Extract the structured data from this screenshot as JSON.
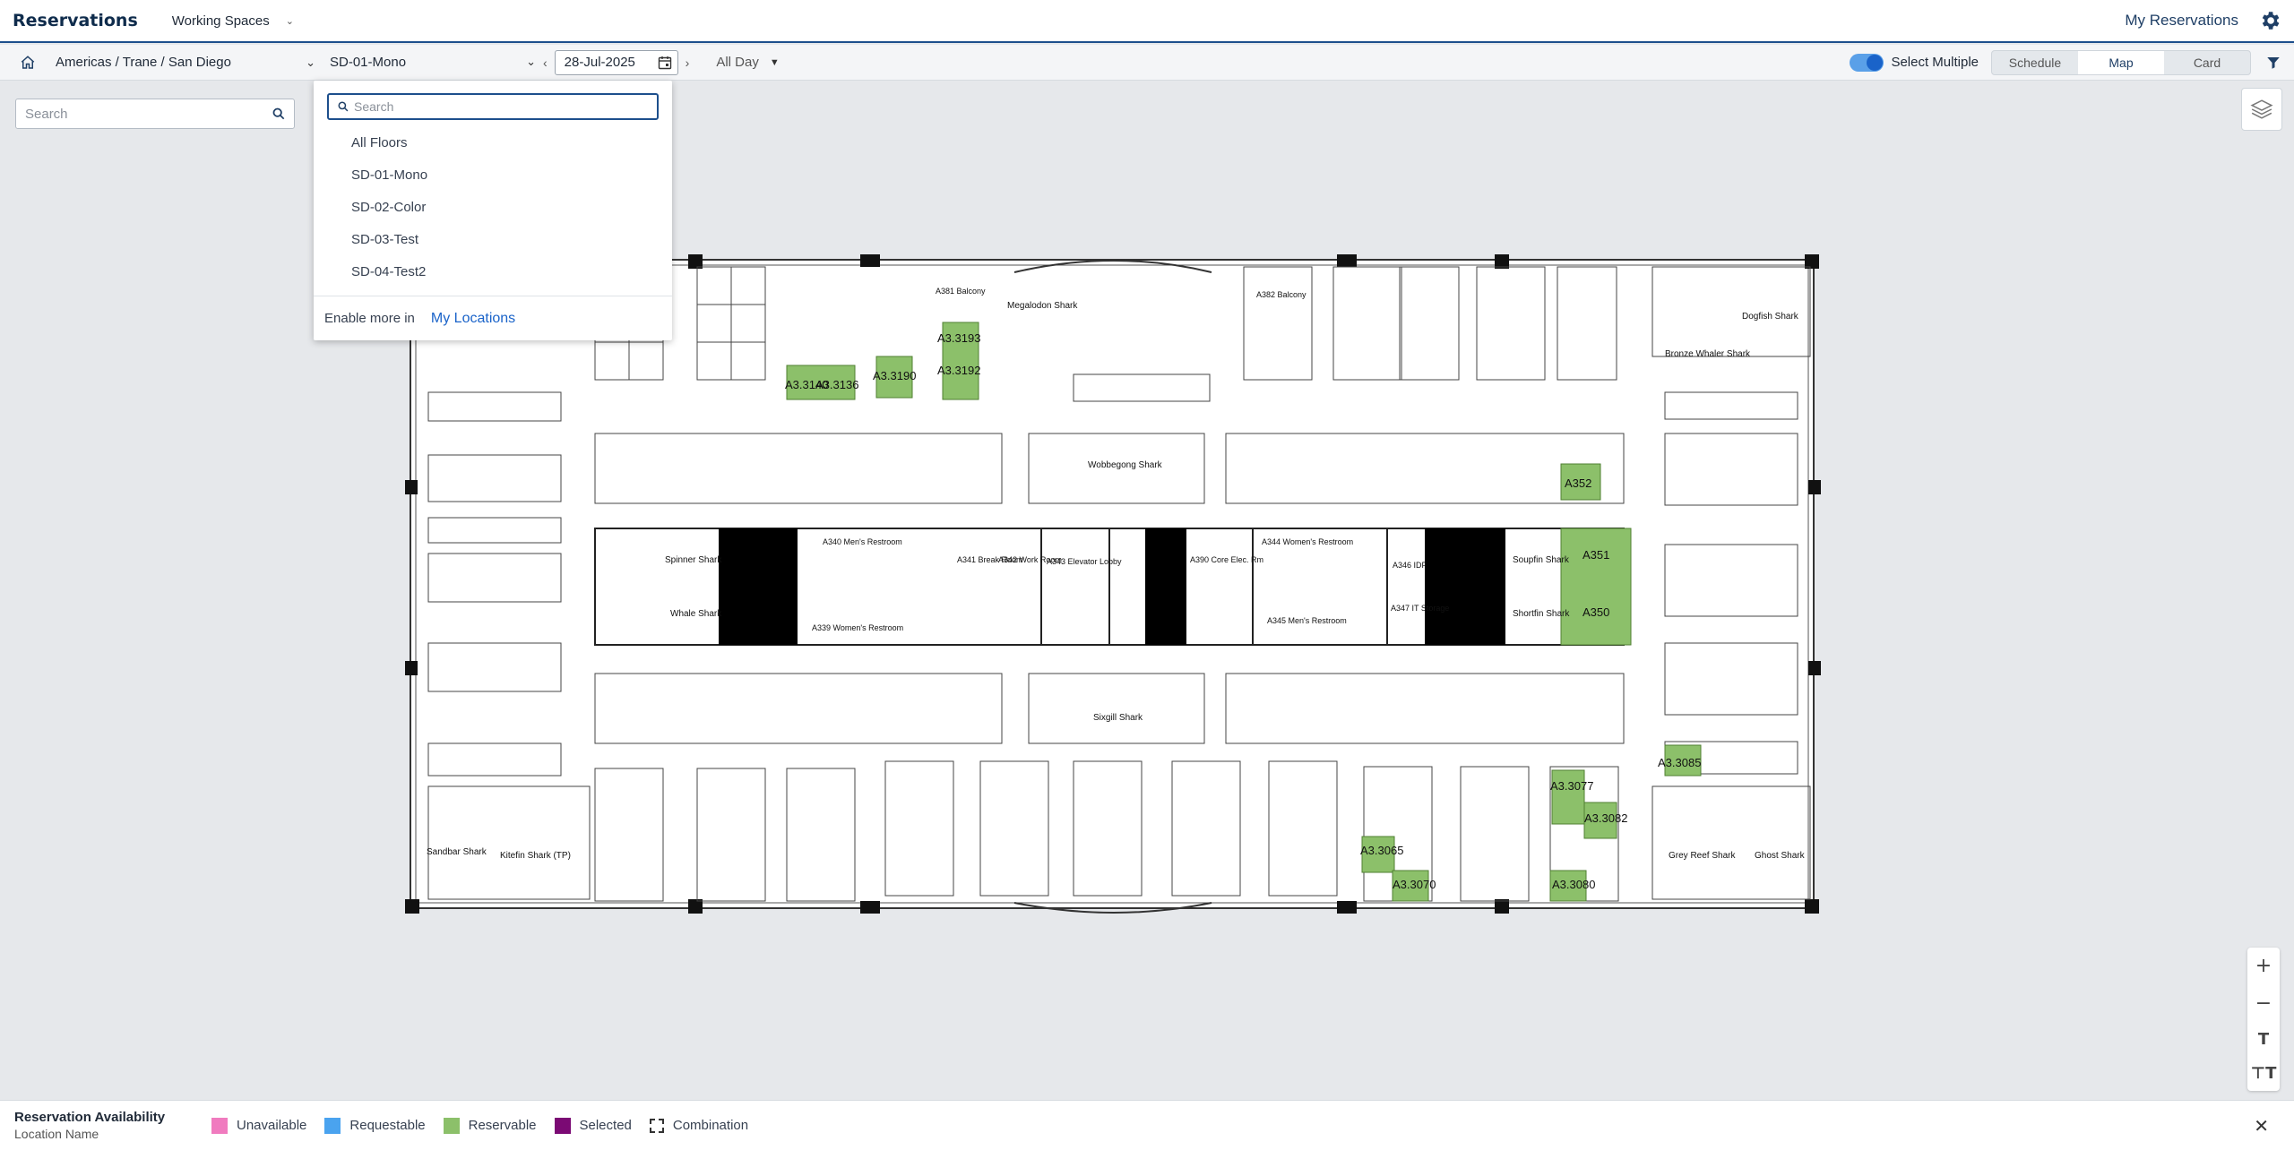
{
  "header": {
    "title": "Reservations",
    "nav_label": "Working Spaces",
    "my_reservations": "My Reservations",
    "settings_icon": "gear-icon"
  },
  "toolbar": {
    "location": "Americas / Trane / San Diego",
    "floor": "SD-01-Mono",
    "date": "28-Jul-2025",
    "time_range": "All Day",
    "select_multiple_label": "Select Multiple",
    "select_multiple_on": true,
    "views": [
      {
        "label": "Schedule",
        "active": false
      },
      {
        "label": "Map",
        "active": true
      },
      {
        "label": "Card",
        "active": false
      }
    ]
  },
  "side_search": {
    "placeholder": "Search"
  },
  "floor_dropdown": {
    "search_placeholder": "Search",
    "items": [
      "All Floors",
      "SD-01-Mono",
      "SD-02-Color",
      "SD-03-Test",
      "SD-04-Test2"
    ],
    "footer_text": "Enable more in",
    "footer_link": "My Locations"
  },
  "map": {
    "reservable_color": "#8cc06a",
    "room_labels": [
      "A3.3140",
      "A3.3136",
      "A3.3190",
      "A3.3193",
      "A3.3192",
      "A352",
      "A351",
      "A350",
      "A3.3085",
      "A3.3077",
      "A3.3082",
      "A3.3065",
      "A3.3070",
      "A3.3080",
      "Megalodon Shark",
      "Wobbegong Shark",
      "Bronze Whaler Shark",
      "Dogfish Shark",
      "Spinner Shark",
      "Whale Shark",
      "Soupfin Shark",
      "Shortfin Shark",
      "Sixgill Shark",
      "Sandbar Shark",
      "Kitefin Shark (TP)",
      "Grey Reef Shark",
      "Ghost Shark",
      "A381 Balcony",
      "A382 Balcony",
      "A340 Men's Restroom",
      "A339 Women's Restroom",
      "A341 Break Room",
      "A342 Work Room",
      "A343 Elevator Lobby",
      "A390 Core Elec. Rm",
      "A344 Women's Restroom",
      "A345 Men's Restroom",
      "A346 IDF",
      "A347 IT Storage"
    ]
  },
  "legend": {
    "title": "Reservation Availability",
    "subtitle": "Location Name",
    "items": [
      {
        "label": "Unavailable",
        "color": "#f07bbf"
      },
      {
        "label": "Requestable",
        "color": "#4aa3ef"
      },
      {
        "label": "Reservable",
        "color": "#8cc06a"
      },
      {
        "label": "Selected",
        "color": "#7b0a74"
      },
      {
        "label": "Combination",
        "color": ""
      }
    ]
  }
}
